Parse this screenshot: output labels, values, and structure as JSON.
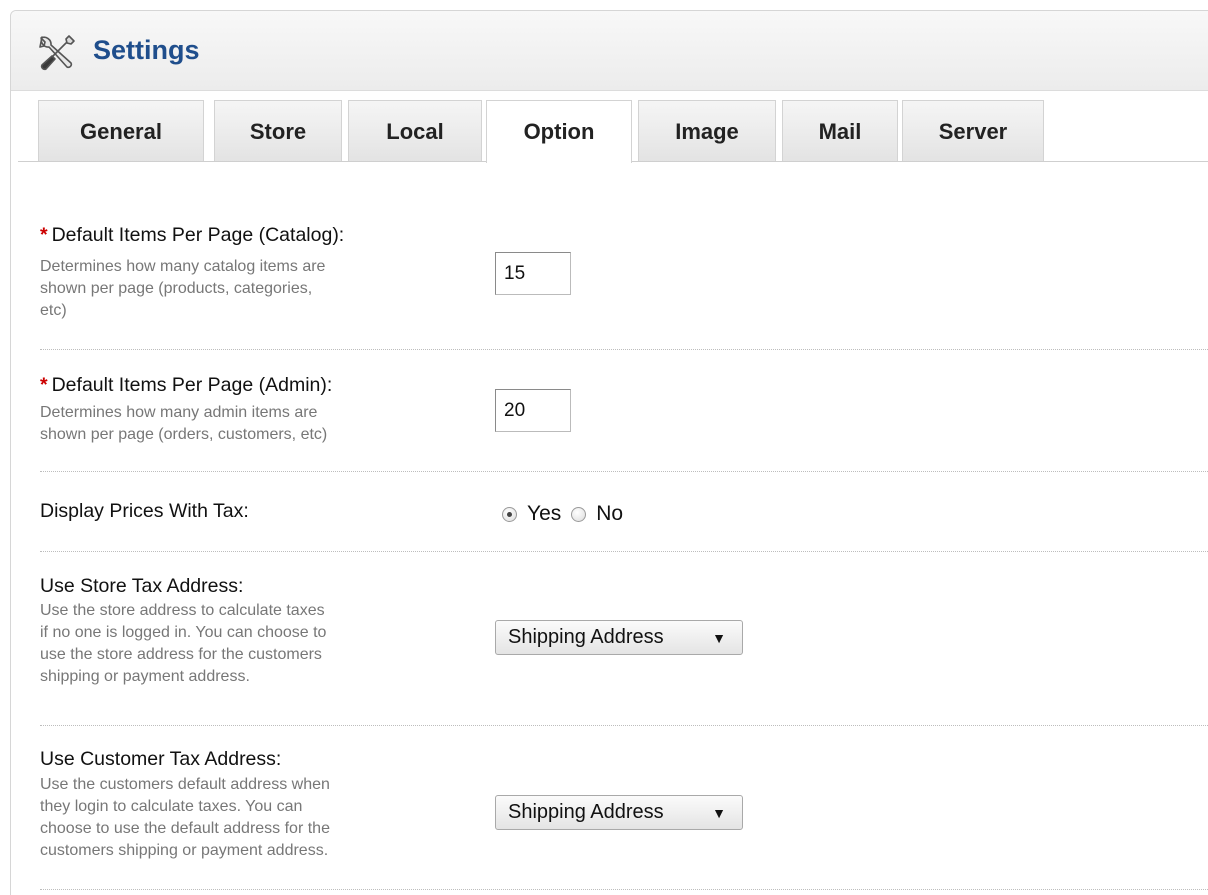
{
  "header": {
    "title": "Settings",
    "icon": "settings-tools-icon"
  },
  "tabs": [
    {
      "label": "General"
    },
    {
      "label": "Store"
    },
    {
      "label": "Local"
    },
    {
      "label": "Option",
      "active": true
    },
    {
      "label": "Image"
    },
    {
      "label": "Mail"
    },
    {
      "label": "Server"
    }
  ],
  "fields": {
    "catalog_items": {
      "required_mark": "*",
      "label": "Default Items Per Page (Catalog):",
      "desc_lines": [
        "Determines how many catalog items are",
        "shown per page (products, categories,",
        "etc)"
      ],
      "value": "15"
    },
    "admin_items": {
      "required_mark": "*",
      "label": "Default Items Per Page (Admin):",
      "desc_lines": [
        "Determines how many admin items are",
        "shown per page (orders, customers, etc)"
      ],
      "value": "20"
    },
    "display_tax": {
      "label": "Display Prices With Tax:",
      "options": [
        "Yes",
        "No"
      ],
      "selected": "Yes"
    },
    "store_tax_address": {
      "label": "Use Store Tax Address:",
      "desc_lines": [
        "Use the store address to calculate taxes",
        "if no one is logged in. You can choose to",
        "use the store address for the customers",
        "shipping or payment address."
      ],
      "selected": "Shipping Address"
    },
    "customer_tax_address": {
      "label": "Use Customer Tax Address:",
      "desc_lines": [
        "Use the customers default address when",
        "they login to calculate taxes. You can",
        "choose to use the default address for the",
        "customers shipping or payment address."
      ],
      "selected": "Shipping Address"
    }
  },
  "colors": {
    "title": "#1f4e8c",
    "required": "#cc0000",
    "description": "#777777"
  }
}
